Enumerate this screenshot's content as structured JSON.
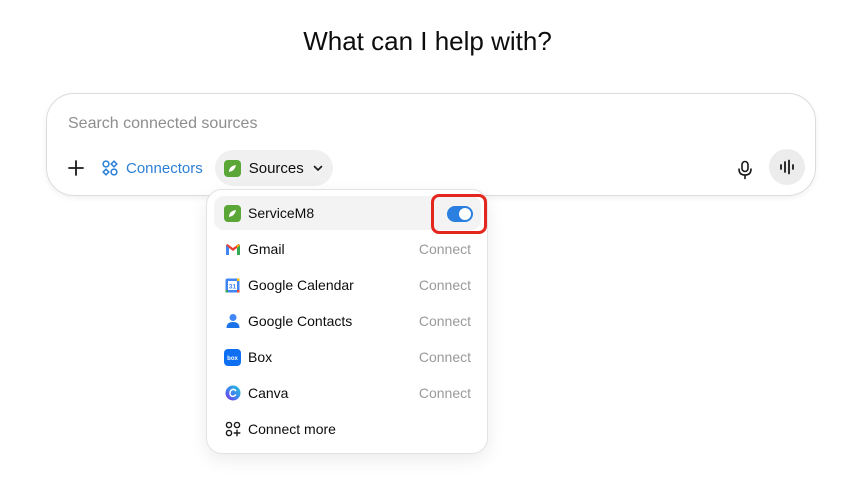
{
  "page": {
    "title": "What can I help with?"
  },
  "composer": {
    "placeholder": "Search connected sources",
    "connectors_label": "Connectors",
    "sources_label": "Sources"
  },
  "sources_menu": {
    "items": [
      {
        "label": "ServiceM8",
        "icon": "servicem8-icon",
        "enabled": true
      },
      {
        "label": "Gmail",
        "icon": "gmail-icon",
        "action": "Connect"
      },
      {
        "label": "Google Calendar",
        "icon": "google-calendar-icon",
        "action": "Connect"
      },
      {
        "label": "Google Contacts",
        "icon": "google-contacts-icon",
        "action": "Connect"
      },
      {
        "label": "Box",
        "icon": "box-icon",
        "action": "Connect"
      },
      {
        "label": "Canva",
        "icon": "canva-icon",
        "action": "Connect"
      },
      {
        "label": "Connect more",
        "icon": "connect-more-icon"
      }
    ]
  },
  "colors": {
    "accent": "#2b7fd6",
    "toggle_on": "#2a7fe0",
    "highlight": "#e4271e",
    "servicem8": "#5aa636"
  }
}
